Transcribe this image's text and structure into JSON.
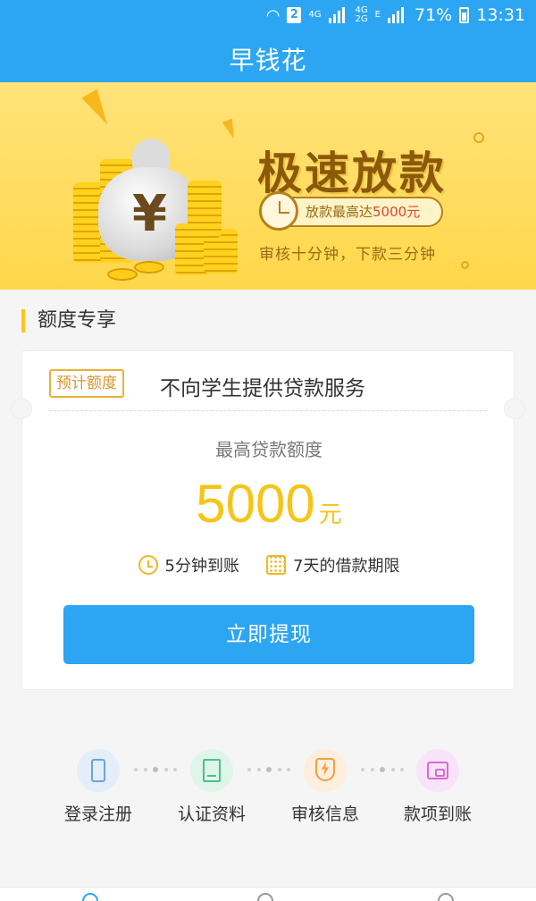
{
  "status_bar": {
    "sim_slot": "2",
    "network_1": "4G",
    "network_2": "4G\n2G",
    "network_3": "E",
    "battery": "71%",
    "time": "13:31"
  },
  "header": {
    "title": "早钱花"
  },
  "banner": {
    "slogan": "极速放款",
    "pill_prefix": "放款最高达",
    "pill_amount": "5000元",
    "sub": "审核十分钟，下款三分钟",
    "yen_symbol": "¥"
  },
  "section": {
    "title": "额度专享"
  },
  "card": {
    "tag": "预计额度",
    "tag_text": "不向学生提供贷款服务",
    "max_label": "最高贷款额度",
    "amount": "5000",
    "amount_unit": "元",
    "feature_1": "5分钟到账",
    "feature_2": "7天的借款期限",
    "button": "立即提现"
  },
  "steps": [
    {
      "label": "登录注册",
      "icon": "phone-icon",
      "color": "#e3eefa"
    },
    {
      "label": "认证资料",
      "icon": "document-icon",
      "color": "#dff5ea"
    },
    {
      "label": "审核信息",
      "icon": "shield-icon",
      "color": "#fdeedd"
    },
    {
      "label": "款项到账",
      "icon": "wallet-icon",
      "color": "#f9e3f9"
    }
  ],
  "colors": {
    "primary": "#2ca6f2",
    "accent_yellow": "#f5c518",
    "banner_bg": "#ffd74a"
  }
}
